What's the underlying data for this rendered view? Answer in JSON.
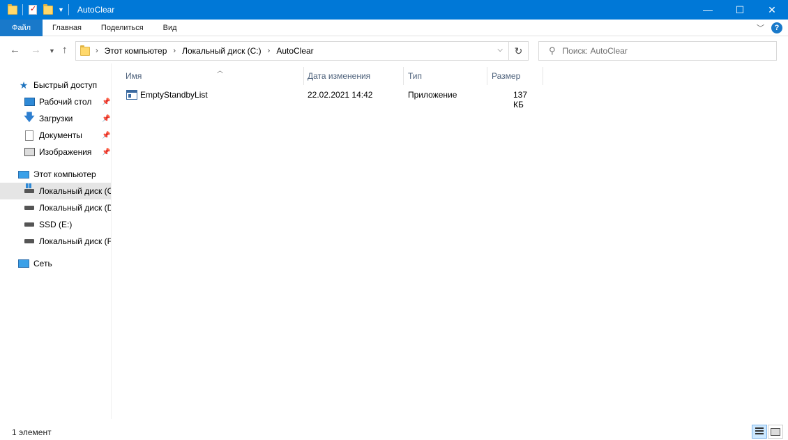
{
  "window": {
    "title": "AutoClear",
    "controls": {
      "minimize": "—",
      "maximize": "☐",
      "close": "✕"
    }
  },
  "ribbon": {
    "tabs": [
      "Файл",
      "Главная",
      "Поделиться",
      "Вид"
    ],
    "help": "?"
  },
  "nav": {
    "breadcrumb": [
      "Этот компьютер",
      "Локальный диск (C:)",
      "AutoClear"
    ],
    "search_placeholder": "Поиск: AutoClear"
  },
  "sidebar": {
    "quick_access": "Быстрый доступ",
    "pinned": [
      "Рабочий стол",
      "Загрузки",
      "Документы",
      "Изображения"
    ],
    "this_pc": "Этот компьютер",
    "drives": [
      "Локальный диск (C:)",
      "Локальный диск (D:)",
      "SSD (E:)",
      "Локальный диск (F:)"
    ],
    "network": "Сеть"
  },
  "columns": [
    "Имя",
    "Дата изменения",
    "Тип",
    "Размер"
  ],
  "files": [
    {
      "name": "EmptyStandbyList",
      "modified": "22.02.2021 14:42",
      "type": "Приложение",
      "size": "137 КБ"
    }
  ],
  "status": {
    "count": "1 элемент"
  },
  "colors": {
    "titlebar": "#0078d7",
    "file_tab": "#1979ca",
    "selection": "#e5e5e5"
  }
}
